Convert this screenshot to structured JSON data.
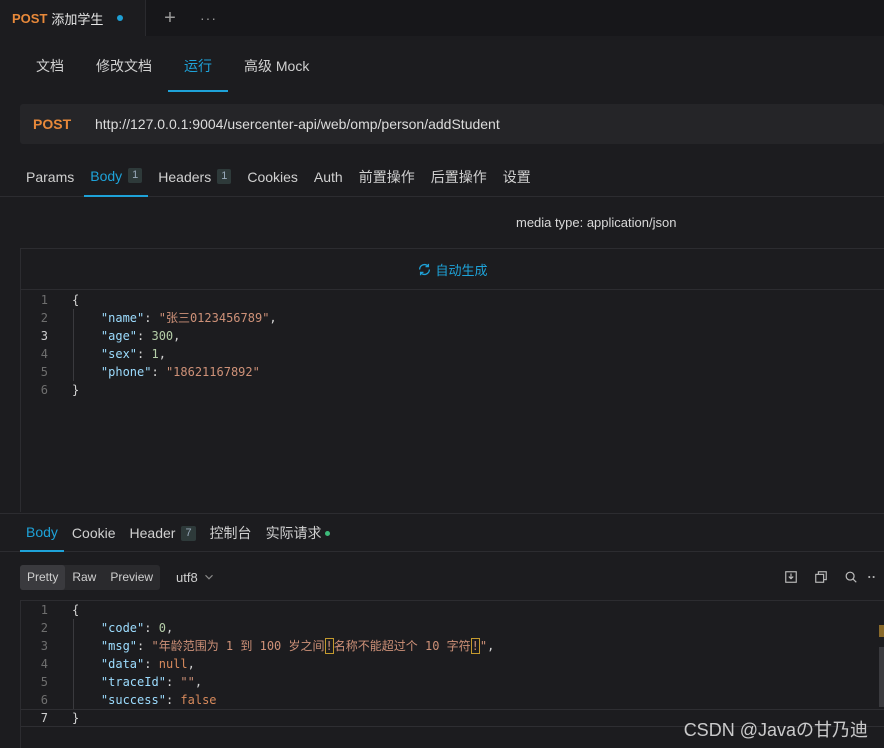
{
  "tab": {
    "method": "POST",
    "title": "添加学生"
  },
  "subnav": [
    "文档",
    "修改文档",
    "运行",
    "高级 Mock"
  ],
  "subnav_active": 2,
  "url": {
    "method": "POST",
    "address": "http://127.0.0.1:9004/usercenter-api/web/omp/person/addStudent"
  },
  "req_tabs": {
    "params": "Params",
    "body": "Body",
    "body_count": "1",
    "headers": "Headers",
    "headers_count": "1",
    "cookies": "Cookies",
    "auth": "Auth",
    "pre": "前置操作",
    "post": "后置操作",
    "settings": "设置"
  },
  "media_type": "media type: application/json",
  "auto_generate": "自动生成",
  "request_lines": [
    "1",
    "2",
    "3",
    "4",
    "5",
    "6"
  ],
  "request_body": {
    "open": "{",
    "name_key": "\"name\"",
    "name_val": "\"张三0123456789\"",
    "age_key": "\"age\"",
    "age_val": "300",
    "sex_key": "\"sex\"",
    "sex_val": "1",
    "phone_key": "\"phone\"",
    "phone_val": "\"18621167892\"",
    "close": "}"
  },
  "resp_tabs": {
    "body": "Body",
    "cookie": "Cookie",
    "header": "Header",
    "header_count": "7",
    "console": "控制台",
    "actual": "实际请求"
  },
  "view_modes": [
    "Pretty",
    "Raw",
    "Preview"
  ],
  "encoding": "utf8",
  "response_lines": [
    "1",
    "2",
    "3",
    "4",
    "5",
    "6",
    "7"
  ],
  "response_body": {
    "open": "{",
    "code_key": "\"code\"",
    "code_val": "0",
    "msg_key": "\"msg\"",
    "msg_val_1": "\"年龄范围为 1 到 100 岁之间",
    "msg_mark_1": "!",
    "msg_val_2": "名称不能超过个 10 字符",
    "msg_mark_2": "!",
    "msg_val_3": "\"",
    "data_key": "\"data\"",
    "data_val": "null",
    "trace_key": "\"traceId\"",
    "trace_val": "\"\"",
    "success_key": "\"success\"",
    "success_val": "false",
    "close": "}"
  },
  "watermark": "CSDN @Javaの甘乃迪"
}
